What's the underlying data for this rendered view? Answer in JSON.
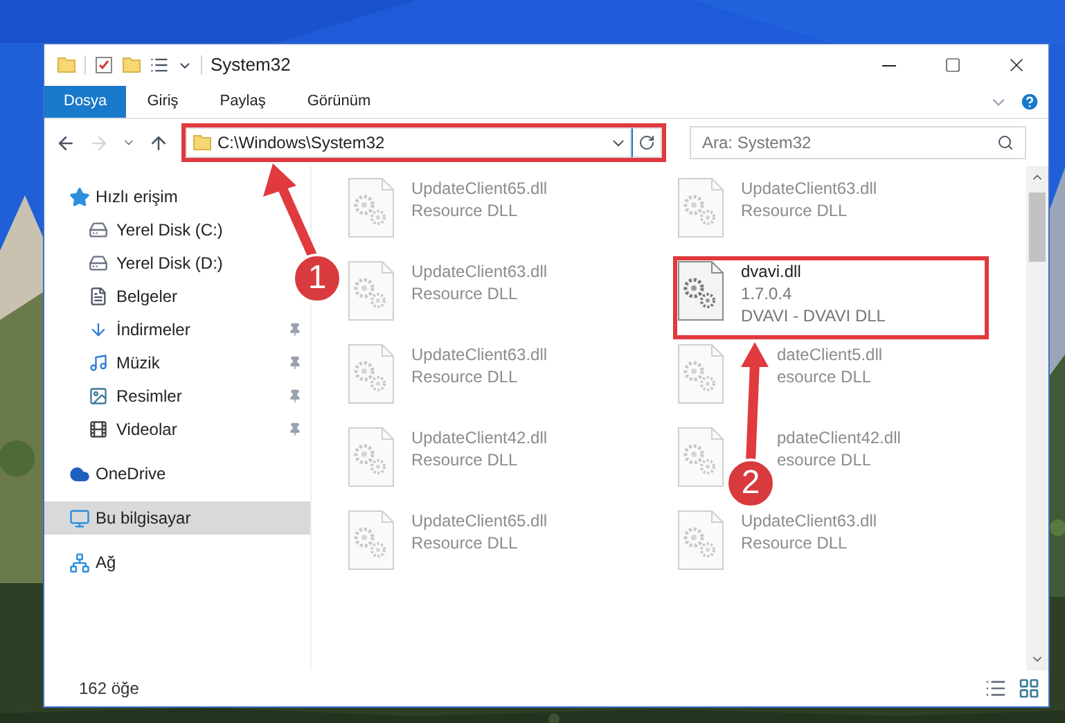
{
  "window": {
    "title": "System32"
  },
  "ribbon_tabs": [
    {
      "label": "Dosya",
      "selected": true
    },
    {
      "label": "Giriş",
      "selected": false
    },
    {
      "label": "Paylaş",
      "selected": false
    },
    {
      "label": "Görünüm",
      "selected": false
    }
  ],
  "address_bar": {
    "path": "C:\\Windows\\System32",
    "highlighted": true
  },
  "search": {
    "placeholder": "Ara: System32"
  },
  "navigation": [
    {
      "label": "Hızlı erişim",
      "selected": false,
      "children": [
        {
          "label": "Yerel Disk (C:)"
        },
        {
          "label": "Yerel Disk (D:)"
        },
        {
          "label": "Belgeler"
        },
        {
          "label": "İndirmeler",
          "pinned": true
        },
        {
          "label": "Müzik",
          "pinned": true
        },
        {
          "label": "Resimler",
          "pinned": true
        },
        {
          "label": "Videolar",
          "pinned": true
        }
      ]
    },
    {
      "label": "OneDrive",
      "selected": false
    },
    {
      "label": "Bu bilgisayar",
      "selected": true
    },
    {
      "label": "Ağ",
      "selected": false
    }
  ],
  "files": [
    {
      "name": "UpdateClient65.dll",
      "description": "Resource DLL",
      "faded": true,
      "highlighted": false
    },
    {
      "name": "UpdateClient63.dll",
      "description": "Resource DLL",
      "faded": true,
      "highlighted": false
    },
    {
      "name": "UpdateClient63.dll",
      "description": "Resource DLL",
      "faded": true,
      "highlighted": false
    },
    {
      "name": "dvavi.dll",
      "version": "1.7.0.4",
      "description": "DVAVI - DVAVI DLL",
      "faded": false,
      "highlighted": true
    },
    {
      "name": "UpdateClient63.dll",
      "description": "Resource DLL",
      "faded": true,
      "highlighted": false
    },
    {
      "name": "dateClient5.dll",
      "description": "esource DLL",
      "faded": true,
      "highlighted": false
    },
    {
      "name": "UpdateClient42.dll",
      "description": "Resource DLL",
      "faded": true,
      "highlighted": false
    },
    {
      "name": "pdateClient42.dll",
      "description": "esource DLL",
      "faded": true,
      "highlighted": false
    },
    {
      "name": "UpdateClient65.dll",
      "description": "Resource DLL",
      "faded": true,
      "highlighted": false
    },
    {
      "name": "UpdateClient63.dll",
      "description": "Resource DLL",
      "faded": true,
      "highlighted": false
    }
  ],
  "status_bar": {
    "item_count": "162 öğe"
  },
  "annotations": [
    {
      "label": "1"
    },
    {
      "label": "2"
    }
  ]
}
